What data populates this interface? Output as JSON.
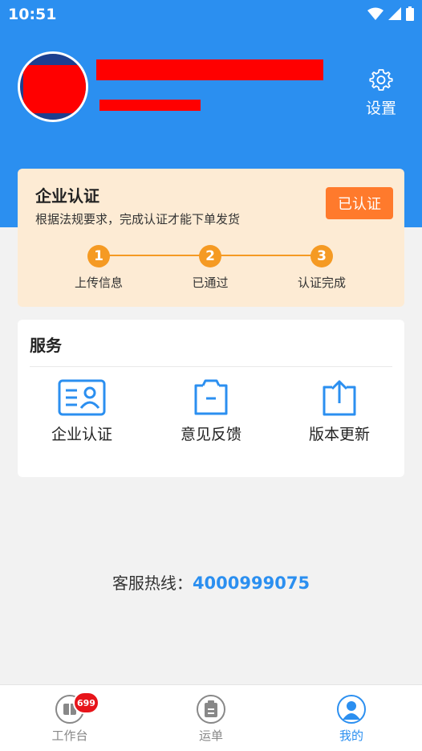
{
  "status_bar": {
    "time": "10:51"
  },
  "profile": {
    "settings_label": "设置"
  },
  "certification": {
    "title": "企业认证",
    "description": "根据法规要求，完成认证才能下单发货",
    "status_button": "已认证",
    "steps": [
      {
        "number": "1",
        "label": "上传信息"
      },
      {
        "number": "2",
        "label": "已通过"
      },
      {
        "number": "3",
        "label": "认证完成"
      }
    ]
  },
  "services": {
    "title": "服务",
    "items": [
      {
        "label": "企业认证",
        "icon": "id-card-icon"
      },
      {
        "label": "意见反馈",
        "icon": "clipboard-icon"
      },
      {
        "label": "版本更新",
        "icon": "upload-icon"
      }
    ]
  },
  "hotline": {
    "label": "客服热线：",
    "number": "4000999075"
  },
  "tabbar": {
    "tabs": [
      {
        "label": "工作台",
        "icon": "workbench-icon",
        "badge": "699",
        "active": false
      },
      {
        "label": "运单",
        "icon": "waybill-icon",
        "active": false
      },
      {
        "label": "我的",
        "icon": "profile-icon",
        "active": true
      }
    ]
  },
  "colors": {
    "primary": "#2b8ff0",
    "accent": "#ff7a2c",
    "step": "#f59a23",
    "badge": "#e7141a"
  }
}
